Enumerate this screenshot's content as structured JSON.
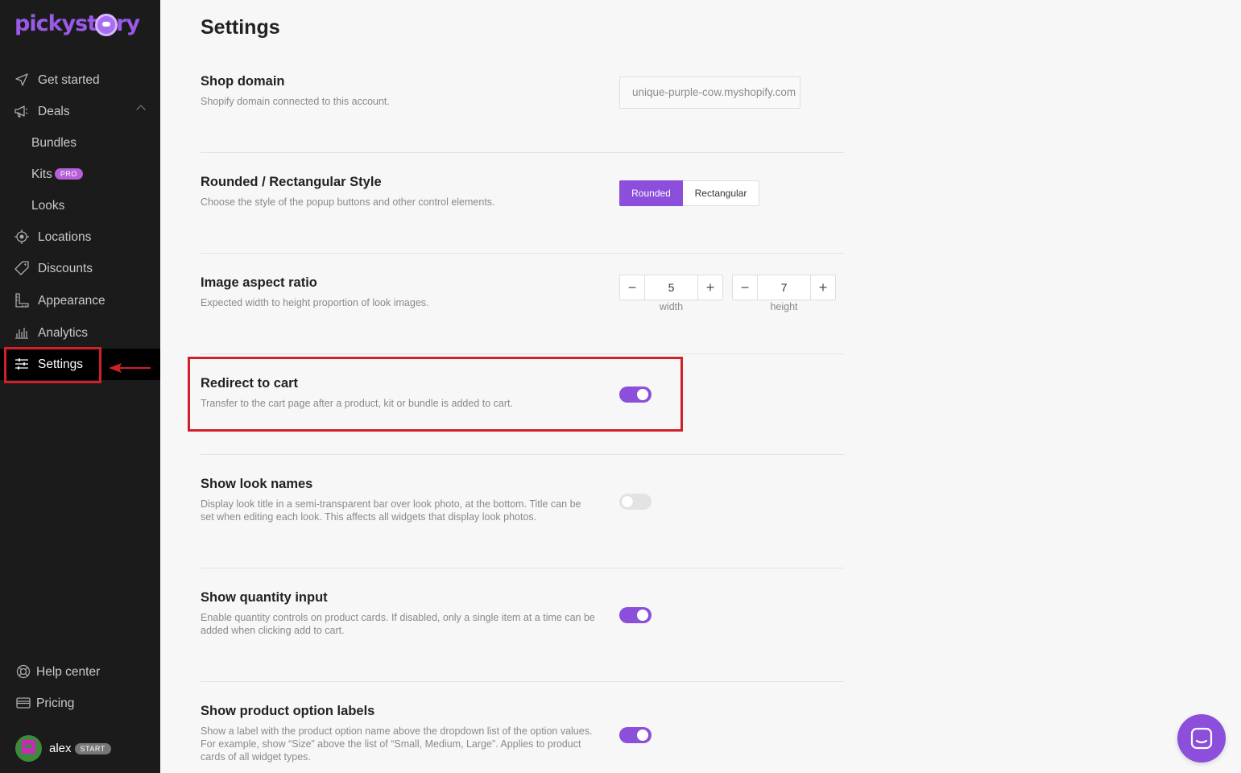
{
  "app": {
    "logo_text_left": "pickyst",
    "logo_text_right": "ry"
  },
  "sidebar": {
    "items": [
      {
        "label": "Get started",
        "icon": "paper-plane-icon"
      },
      {
        "label": "Deals",
        "icon": "megaphone-icon"
      },
      {
        "label": "Bundles"
      },
      {
        "label": "Kits",
        "badge": "PRO"
      },
      {
        "label": "Looks"
      },
      {
        "label": "Locations",
        "icon": "target-icon"
      },
      {
        "label": "Discounts",
        "icon": "tag-icon"
      },
      {
        "label": "Appearance",
        "icon": "ruler-icon"
      },
      {
        "label": "Analytics",
        "icon": "bar-chart-icon"
      },
      {
        "label": "Settings",
        "icon": "sliders-icon"
      }
    ],
    "footer": [
      {
        "label": "Help center",
        "icon": "lifebuoy-icon"
      },
      {
        "label": "Pricing",
        "icon": "credit-card-icon"
      }
    ],
    "user": {
      "name": "alex",
      "plan": "START"
    }
  },
  "main": {
    "title": "Settings",
    "settings": [
      {
        "title": "Shop domain",
        "desc": "Shopify domain connected to this account.",
        "value": "unique-purple-cow.myshopify.com"
      },
      {
        "title": "Rounded / Rectangular Style",
        "desc": "Choose the style of the popup buttons and other control elements.",
        "options": [
          "Rounded",
          "Rectangular"
        ],
        "selected": "Rounded"
      },
      {
        "title": "Image aspect ratio",
        "desc": "Expected width to height proportion of look images.",
        "width": "5",
        "height": "7",
        "width_label": "width",
        "height_label": "height"
      },
      {
        "title": "Redirect to cart",
        "desc": "Transfer to the cart page after a product, kit or bundle is added to cart.",
        "enabled": true
      },
      {
        "title": "Show look names",
        "desc": "Display look title in a semi-transparent bar over look photo, at the bottom. Title can be set when editing each look. This affects all widgets that display look photos.",
        "enabled": false
      },
      {
        "title": "Show quantity input",
        "desc": "Enable quantity controls on product cards. If disabled, only a single item at a time can be added when clicking add to cart.",
        "enabled": true
      },
      {
        "title": "Show product option labels",
        "desc": "Show a label with the product option name above the dropdown list of the option values. For example, show “Size” above the list of “Small, Medium, Large”. Applies to product cards of all widget types.",
        "enabled": true
      }
    ],
    "stepper_minus": "−",
    "stepper_plus": "+"
  },
  "colors": {
    "accent": "#8c4fdc",
    "sidebar_bg": "#1b1b1b",
    "highlight": "#d0202a"
  }
}
